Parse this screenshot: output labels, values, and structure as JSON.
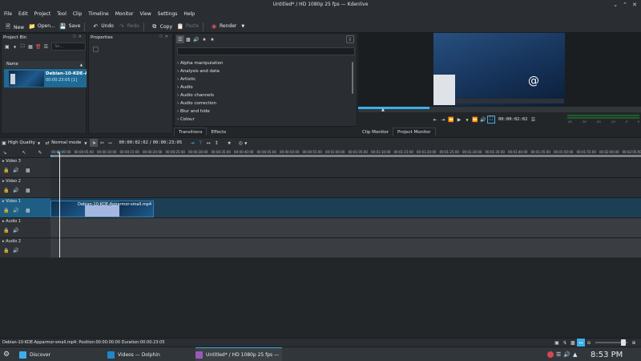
{
  "window": {
    "title": "Untitled* / HD 1080p 25 fps — Kdenlive"
  },
  "menu": [
    "File",
    "Edit",
    "Project",
    "Tool",
    "Clip",
    "Timeline",
    "Monitor",
    "View",
    "Settings",
    "Help"
  ],
  "toolbar": {
    "new": "New",
    "open": "Open...",
    "save": "Save",
    "undo": "Undo",
    "redo": "Redo",
    "copy": "Copy",
    "paste": "Paste",
    "render": "Render"
  },
  "project_bin": {
    "title": "Project Bin",
    "search_placeholder": "Se...",
    "column_name": "Name",
    "clip": {
      "name": "Debian-10-KDE-Appar",
      "duration": "00:00:23:05",
      "count": "[1]"
    }
  },
  "properties": {
    "title": "Properties"
  },
  "effects": {
    "items": [
      "Alpha manipulation",
      "Analysis and data",
      "Artistic",
      "Audio",
      "Audio channels",
      "Audio correction",
      "Blur and hide",
      "Colour"
    ],
    "tabs": [
      "Transitions",
      "Effects"
    ]
  },
  "monitor": {
    "timecode": "00:00:02:02",
    "tabs": [
      "Clip Monitor",
      "Project Monitor"
    ],
    "audio_scale": [
      "-45",
      "-30",
      "-20",
      "-10",
      "-5",
      "0"
    ]
  },
  "timeline_toolbar": {
    "quality": "High Quality",
    "mode": "Normal mode",
    "position": "00:00:02:02",
    "duration": "00:00:23:05"
  },
  "ruler": [
    "00:00:00:00",
    "00:00:05:00",
    "00:00:10:00",
    "00:00:15:00",
    "00:00:20:00",
    "00:00:25:00",
    "00:00:30:00",
    "00:00:35:00",
    "00:00:40:00",
    "00:00:45:00",
    "00:00:50:00",
    "00:00:55:00",
    "00:01:00:00",
    "00:01:05:00",
    "00:01:10:00",
    "00:01:15:00",
    "00:01:20:00",
    "00:01:25:00",
    "00:01:30:00",
    "00:01:35:00",
    "00:01:40:00",
    "00:01:45:00",
    "00:01:50:00",
    "00:01:55:00",
    "00:02:00:00",
    "00:02:05:00",
    "00:02:10:00"
  ],
  "tracks": [
    "Video 3",
    "Video 2",
    "Video 1",
    "Audio 1",
    "Audio 2"
  ],
  "timeline_clip": {
    "name": "Debian-10-KDE-Apparmor-small.mp4"
  },
  "status": {
    "message": "Debian-10-KDE-Apparmor-small.mp4: Position:00:00:00:00 Duration:00:00:23:05"
  },
  "taskbar": {
    "tasks": [
      "Discover",
      "Videos — Dolphin",
      "Untitled* / HD 1080p 25 fps — Kdenlive"
    ],
    "clock": "8:53 PM"
  },
  "colors": {
    "accent": "#3daee9",
    "clip": "#1d4b6c",
    "bg": "#232629",
    "panel": "#2a2e32"
  }
}
